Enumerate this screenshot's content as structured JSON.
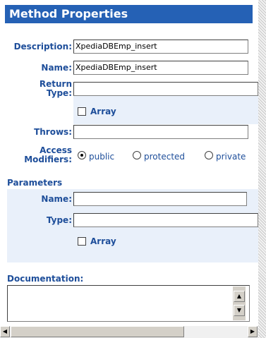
{
  "title": "Method Properties",
  "fields": {
    "description_label": "Description:",
    "description_value": "XpediaDBEmp_insert",
    "name_label": "Name:",
    "name_value": "XpediaDBEmp_insert",
    "return_type_label_1": "Return",
    "return_type_label_2": "Type:",
    "return_type_value": "",
    "return_array_label": "Array",
    "throws_label": "Throws:",
    "throws_value": "",
    "access_label_1": "Access",
    "access_label_2": "Modifiers:"
  },
  "access_modifiers": {
    "options": [
      "public",
      "protected",
      "private"
    ],
    "selected": "public"
  },
  "parameters": {
    "section_label": "Parameters",
    "name_label": "Name:",
    "name_value": "",
    "type_label": "Type:",
    "type_value": "",
    "array_label": "Array"
  },
  "documentation": {
    "label": "Documentation:",
    "value": ""
  },
  "scroll": {
    "up_icon": "▲",
    "down_icon": "▼",
    "left_icon": "◀",
    "right_icon": "▶"
  }
}
